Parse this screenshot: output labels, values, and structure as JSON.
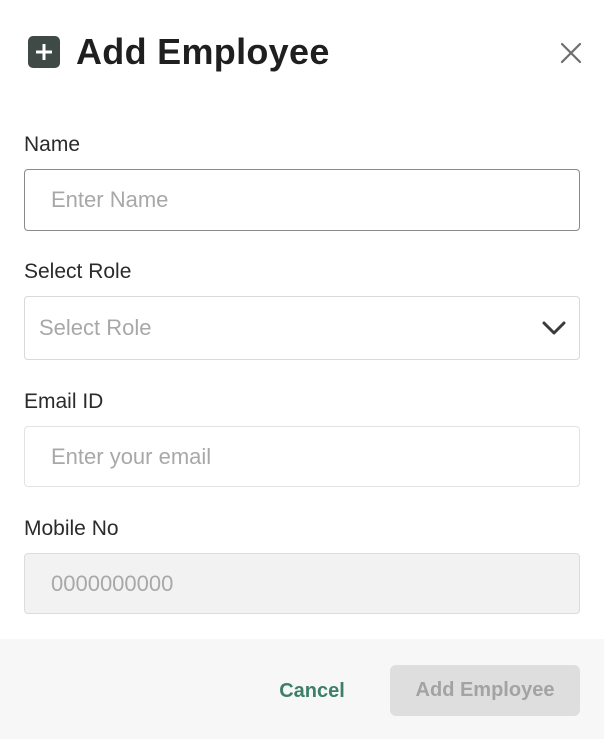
{
  "modal": {
    "title": "Add Employee",
    "header_icon": "plus-square-icon",
    "close_icon": "close-icon"
  },
  "form": {
    "name": {
      "label": "Name",
      "placeholder": "Enter Name",
      "value": ""
    },
    "role": {
      "label": "Select Role",
      "selected": "Select Role",
      "icon": "chevron-down-icon"
    },
    "email": {
      "label": "Email ID",
      "placeholder": "Enter your email",
      "value": ""
    },
    "mobile": {
      "label": "Mobile No",
      "placeholder": "0000000000",
      "value": ""
    }
  },
  "footer": {
    "cancel_label": "Cancel",
    "submit_label": "Add Employee"
  },
  "colors": {
    "header_icon_bg": "#3f4a47",
    "cancel_text": "#3d7f6b",
    "submit_bg_disabled": "#dedede",
    "submit_text_disabled": "#a3a3a3",
    "footer_bg": "#f7f7f7",
    "disabled_input_bg": "#f2f2f2"
  }
}
